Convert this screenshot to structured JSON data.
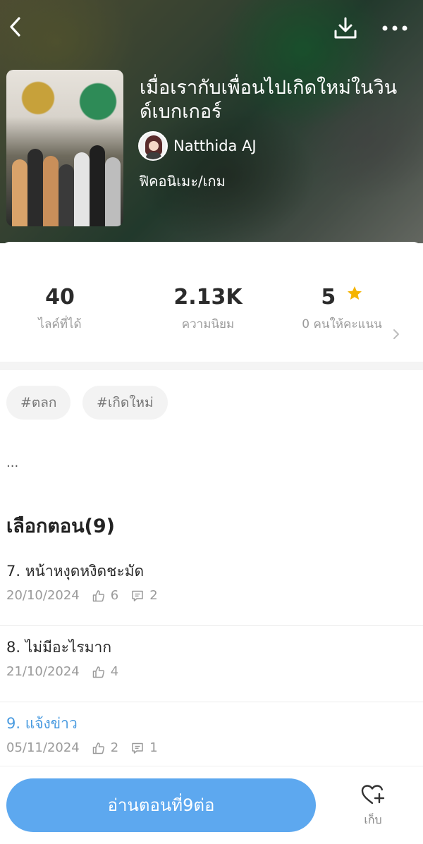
{
  "book": {
    "title": "เมื่อเรากับเพื่อนไปเกิดใหม่ในวินด์เบกเกอร์",
    "author": "Natthida AJ",
    "genre": "ฟิคอนิเมะ/เกม"
  },
  "stats": {
    "likes_value": "40",
    "likes_label": "ไลค์ที่ได้",
    "popularity_value": "2.13K",
    "popularity_label": "ความนิยม",
    "rating_value": "5",
    "rating_label": "0 คนให้คะแนน"
  },
  "tags": [
    "#ตลก",
    "#เกิดใหม่"
  ],
  "description": "...",
  "episodes_section": {
    "title": "เลือกตอน(9)"
  },
  "episodes": [
    {
      "title": "7. หน้าหงุดหงิดชะมัด",
      "date": "20/10/2024",
      "likes": "6",
      "comments": "2"
    },
    {
      "title": "8. ไม่มีอะไรมาก",
      "date": "21/10/2024",
      "likes": "4",
      "comments": ""
    },
    {
      "title": "9. แจ้งข่าว",
      "date": "05/11/2024",
      "likes": "2",
      "comments": "1"
    }
  ],
  "bottom": {
    "read_button": "อ่านตอนที่9ต่อ",
    "collect_label": "เก็บ"
  },
  "colors": {
    "accent": "#5da8ef",
    "current_episode": "#4a9be0",
    "star": "#f5b400"
  },
  "icons": {
    "back": "chevron-left-icon",
    "download": "download-icon",
    "more": "more-dots-icon",
    "like": "thumbs-up-icon",
    "comment": "comment-icon",
    "collect": "heart-plus-icon",
    "rating": "star-icon"
  }
}
